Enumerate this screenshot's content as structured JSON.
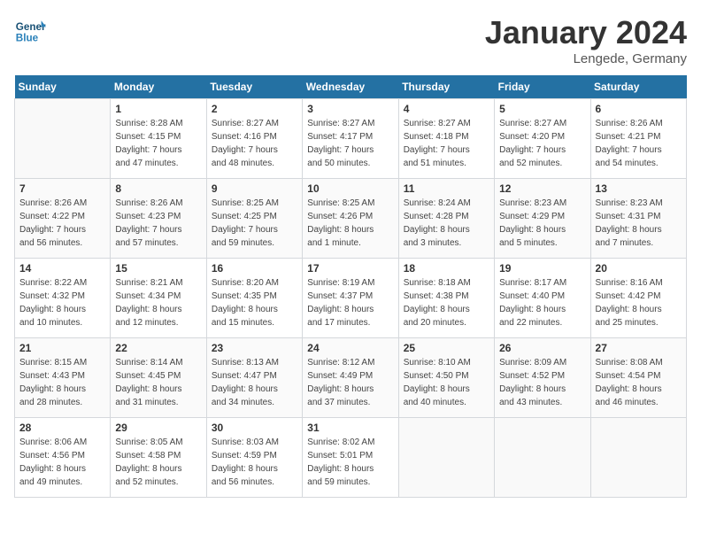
{
  "header": {
    "logo_general": "General",
    "logo_blue": "Blue",
    "month_title": "January 2024",
    "subtitle": "Lengede, Germany"
  },
  "days_of_week": [
    "Sunday",
    "Monday",
    "Tuesday",
    "Wednesday",
    "Thursday",
    "Friday",
    "Saturday"
  ],
  "weeks": [
    [
      {
        "day": "",
        "info": ""
      },
      {
        "day": "1",
        "info": "Sunrise: 8:28 AM\nSunset: 4:15 PM\nDaylight: 7 hours\nand 47 minutes."
      },
      {
        "day": "2",
        "info": "Sunrise: 8:27 AM\nSunset: 4:16 PM\nDaylight: 7 hours\nand 48 minutes."
      },
      {
        "day": "3",
        "info": "Sunrise: 8:27 AM\nSunset: 4:17 PM\nDaylight: 7 hours\nand 50 minutes."
      },
      {
        "day": "4",
        "info": "Sunrise: 8:27 AM\nSunset: 4:18 PM\nDaylight: 7 hours\nand 51 minutes."
      },
      {
        "day": "5",
        "info": "Sunrise: 8:27 AM\nSunset: 4:20 PM\nDaylight: 7 hours\nand 52 minutes."
      },
      {
        "day": "6",
        "info": "Sunrise: 8:26 AM\nSunset: 4:21 PM\nDaylight: 7 hours\nand 54 minutes."
      }
    ],
    [
      {
        "day": "7",
        "info": "Sunrise: 8:26 AM\nSunset: 4:22 PM\nDaylight: 7 hours\nand 56 minutes."
      },
      {
        "day": "8",
        "info": "Sunrise: 8:26 AM\nSunset: 4:23 PM\nDaylight: 7 hours\nand 57 minutes."
      },
      {
        "day": "9",
        "info": "Sunrise: 8:25 AM\nSunset: 4:25 PM\nDaylight: 7 hours\nand 59 minutes."
      },
      {
        "day": "10",
        "info": "Sunrise: 8:25 AM\nSunset: 4:26 PM\nDaylight: 8 hours\nand 1 minute."
      },
      {
        "day": "11",
        "info": "Sunrise: 8:24 AM\nSunset: 4:28 PM\nDaylight: 8 hours\nand 3 minutes."
      },
      {
        "day": "12",
        "info": "Sunrise: 8:23 AM\nSunset: 4:29 PM\nDaylight: 8 hours\nand 5 minutes."
      },
      {
        "day": "13",
        "info": "Sunrise: 8:23 AM\nSunset: 4:31 PM\nDaylight: 8 hours\nand 7 minutes."
      }
    ],
    [
      {
        "day": "14",
        "info": "Sunrise: 8:22 AM\nSunset: 4:32 PM\nDaylight: 8 hours\nand 10 minutes."
      },
      {
        "day": "15",
        "info": "Sunrise: 8:21 AM\nSunset: 4:34 PM\nDaylight: 8 hours\nand 12 minutes."
      },
      {
        "day": "16",
        "info": "Sunrise: 8:20 AM\nSunset: 4:35 PM\nDaylight: 8 hours\nand 15 minutes."
      },
      {
        "day": "17",
        "info": "Sunrise: 8:19 AM\nSunset: 4:37 PM\nDaylight: 8 hours\nand 17 minutes."
      },
      {
        "day": "18",
        "info": "Sunrise: 8:18 AM\nSunset: 4:38 PM\nDaylight: 8 hours\nand 20 minutes."
      },
      {
        "day": "19",
        "info": "Sunrise: 8:17 AM\nSunset: 4:40 PM\nDaylight: 8 hours\nand 22 minutes."
      },
      {
        "day": "20",
        "info": "Sunrise: 8:16 AM\nSunset: 4:42 PM\nDaylight: 8 hours\nand 25 minutes."
      }
    ],
    [
      {
        "day": "21",
        "info": "Sunrise: 8:15 AM\nSunset: 4:43 PM\nDaylight: 8 hours\nand 28 minutes."
      },
      {
        "day": "22",
        "info": "Sunrise: 8:14 AM\nSunset: 4:45 PM\nDaylight: 8 hours\nand 31 minutes."
      },
      {
        "day": "23",
        "info": "Sunrise: 8:13 AM\nSunset: 4:47 PM\nDaylight: 8 hours\nand 34 minutes."
      },
      {
        "day": "24",
        "info": "Sunrise: 8:12 AM\nSunset: 4:49 PM\nDaylight: 8 hours\nand 37 minutes."
      },
      {
        "day": "25",
        "info": "Sunrise: 8:10 AM\nSunset: 4:50 PM\nDaylight: 8 hours\nand 40 minutes."
      },
      {
        "day": "26",
        "info": "Sunrise: 8:09 AM\nSunset: 4:52 PM\nDaylight: 8 hours\nand 43 minutes."
      },
      {
        "day": "27",
        "info": "Sunrise: 8:08 AM\nSunset: 4:54 PM\nDaylight: 8 hours\nand 46 minutes."
      }
    ],
    [
      {
        "day": "28",
        "info": "Sunrise: 8:06 AM\nSunset: 4:56 PM\nDaylight: 8 hours\nand 49 minutes."
      },
      {
        "day": "29",
        "info": "Sunrise: 8:05 AM\nSunset: 4:58 PM\nDaylight: 8 hours\nand 52 minutes."
      },
      {
        "day": "30",
        "info": "Sunrise: 8:03 AM\nSunset: 4:59 PM\nDaylight: 8 hours\nand 56 minutes."
      },
      {
        "day": "31",
        "info": "Sunrise: 8:02 AM\nSunset: 5:01 PM\nDaylight: 8 hours\nand 59 minutes."
      },
      {
        "day": "",
        "info": ""
      },
      {
        "day": "",
        "info": ""
      },
      {
        "day": "",
        "info": ""
      }
    ]
  ]
}
